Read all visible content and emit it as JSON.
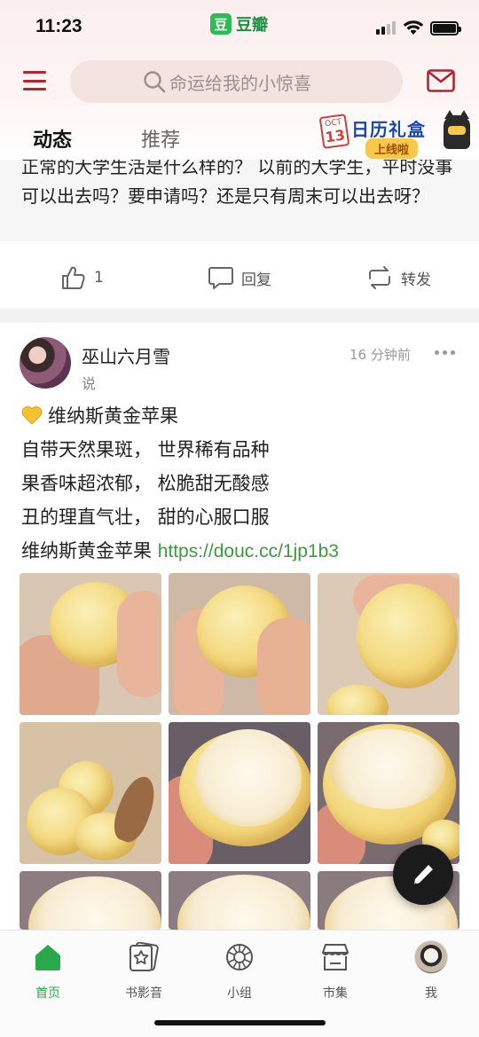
{
  "status_bar": {
    "time": "11:23",
    "app_logo_char": "豆",
    "app_name": "豆瓣"
  },
  "header": {
    "search_placeholder": "命运给我的小惊喜",
    "tabs": [
      {
        "label": "动态",
        "active": true
      },
      {
        "label": "推荐",
        "active": false
      }
    ],
    "promo": {
      "calendar_month": "OCT",
      "calendar_day": "13",
      "title": "日历礼盒",
      "subtitle": "上线啦"
    }
  },
  "prev_post": {
    "text": "正常的大学生活是什么样的？ 以前的大学生，平时没事可以出去吗？要申请吗？还是只有周末可以出去呀？",
    "like_count": "1",
    "reply_label": "回复",
    "repost_label": "转发"
  },
  "post": {
    "author": "巫山六月雪",
    "action": "说",
    "time": "16 分钟前",
    "lines": [
      "维纳斯黄金苹果",
      "自带天然果斑， 世界稀有品种",
      "果香味超浓郁， 松脆甜无酸感",
      "丑的理直气壮， 甜的心服口服"
    ],
    "last_line_prefix": "维纳斯黄金苹果 ",
    "link": "https://douc.cc/1jp1b3"
  },
  "bottom_nav": [
    {
      "label": "首页",
      "icon": "home-icon",
      "active": true
    },
    {
      "label": "书影音",
      "icon": "star-card-icon",
      "active": false
    },
    {
      "label": "小组",
      "icon": "group-icon",
      "active": false
    },
    {
      "label": "市集",
      "icon": "market-icon",
      "active": false
    },
    {
      "label": "我",
      "icon": "profile-avatar",
      "active": false
    }
  ],
  "colors": {
    "brand_red": "#b0262e",
    "brand_green": "#2aa84c",
    "link_green": "#3c9b3c"
  }
}
